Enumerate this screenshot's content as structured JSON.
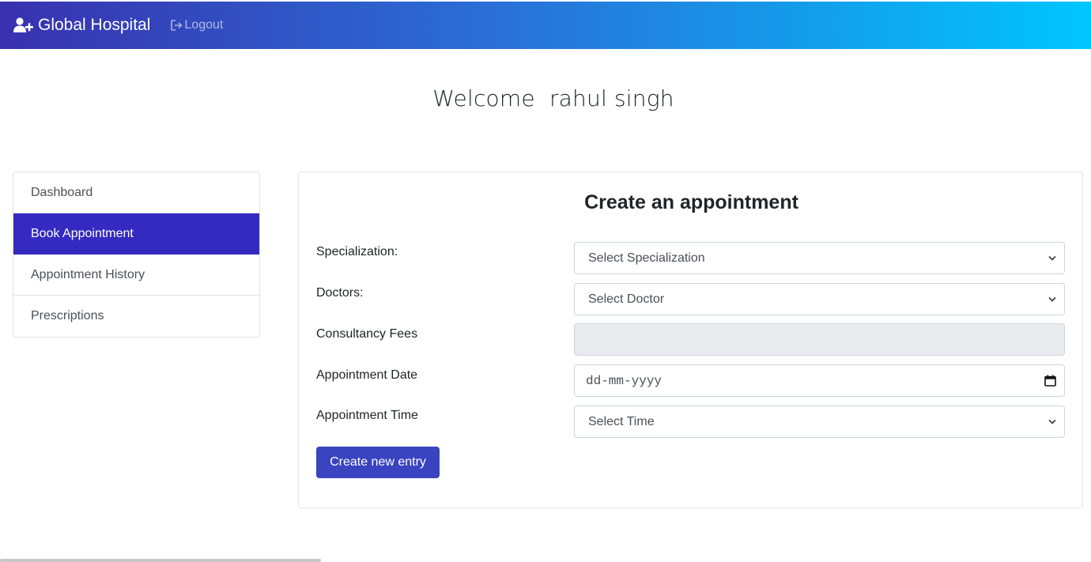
{
  "navbar": {
    "brand": "Global Hospital",
    "brand_icon": "user-plus-icon",
    "logout_label": "Logout",
    "logout_icon": "sign-out-icon",
    "gradient": [
      "#3931af",
      "#00c6ff"
    ]
  },
  "welcome": {
    "text": "Welcome  rahul singh"
  },
  "sidebar": {
    "items": [
      {
        "label": "Dashboard",
        "active": false
      },
      {
        "label": "Book Appointment",
        "active": true
      },
      {
        "label": "Appointment History",
        "active": false
      },
      {
        "label": "Prescriptions",
        "active": false
      }
    ],
    "active_color": "#342ac1"
  },
  "form": {
    "title": "Create an appointment",
    "fields": {
      "specialization": {
        "label": "Specialization:",
        "value": "Select Specialization"
      },
      "doctors": {
        "label": "Doctors:",
        "value": "Select Doctor"
      },
      "fees": {
        "label": "Consultancy Fees",
        "value": ""
      },
      "date": {
        "label": "Appointment Date",
        "placeholder": "dd-mm-yyyy"
      },
      "time": {
        "label": "Appointment Time",
        "value": "Select Time"
      }
    },
    "submit_label": "Create new entry",
    "button_color": "#3a44c0"
  }
}
